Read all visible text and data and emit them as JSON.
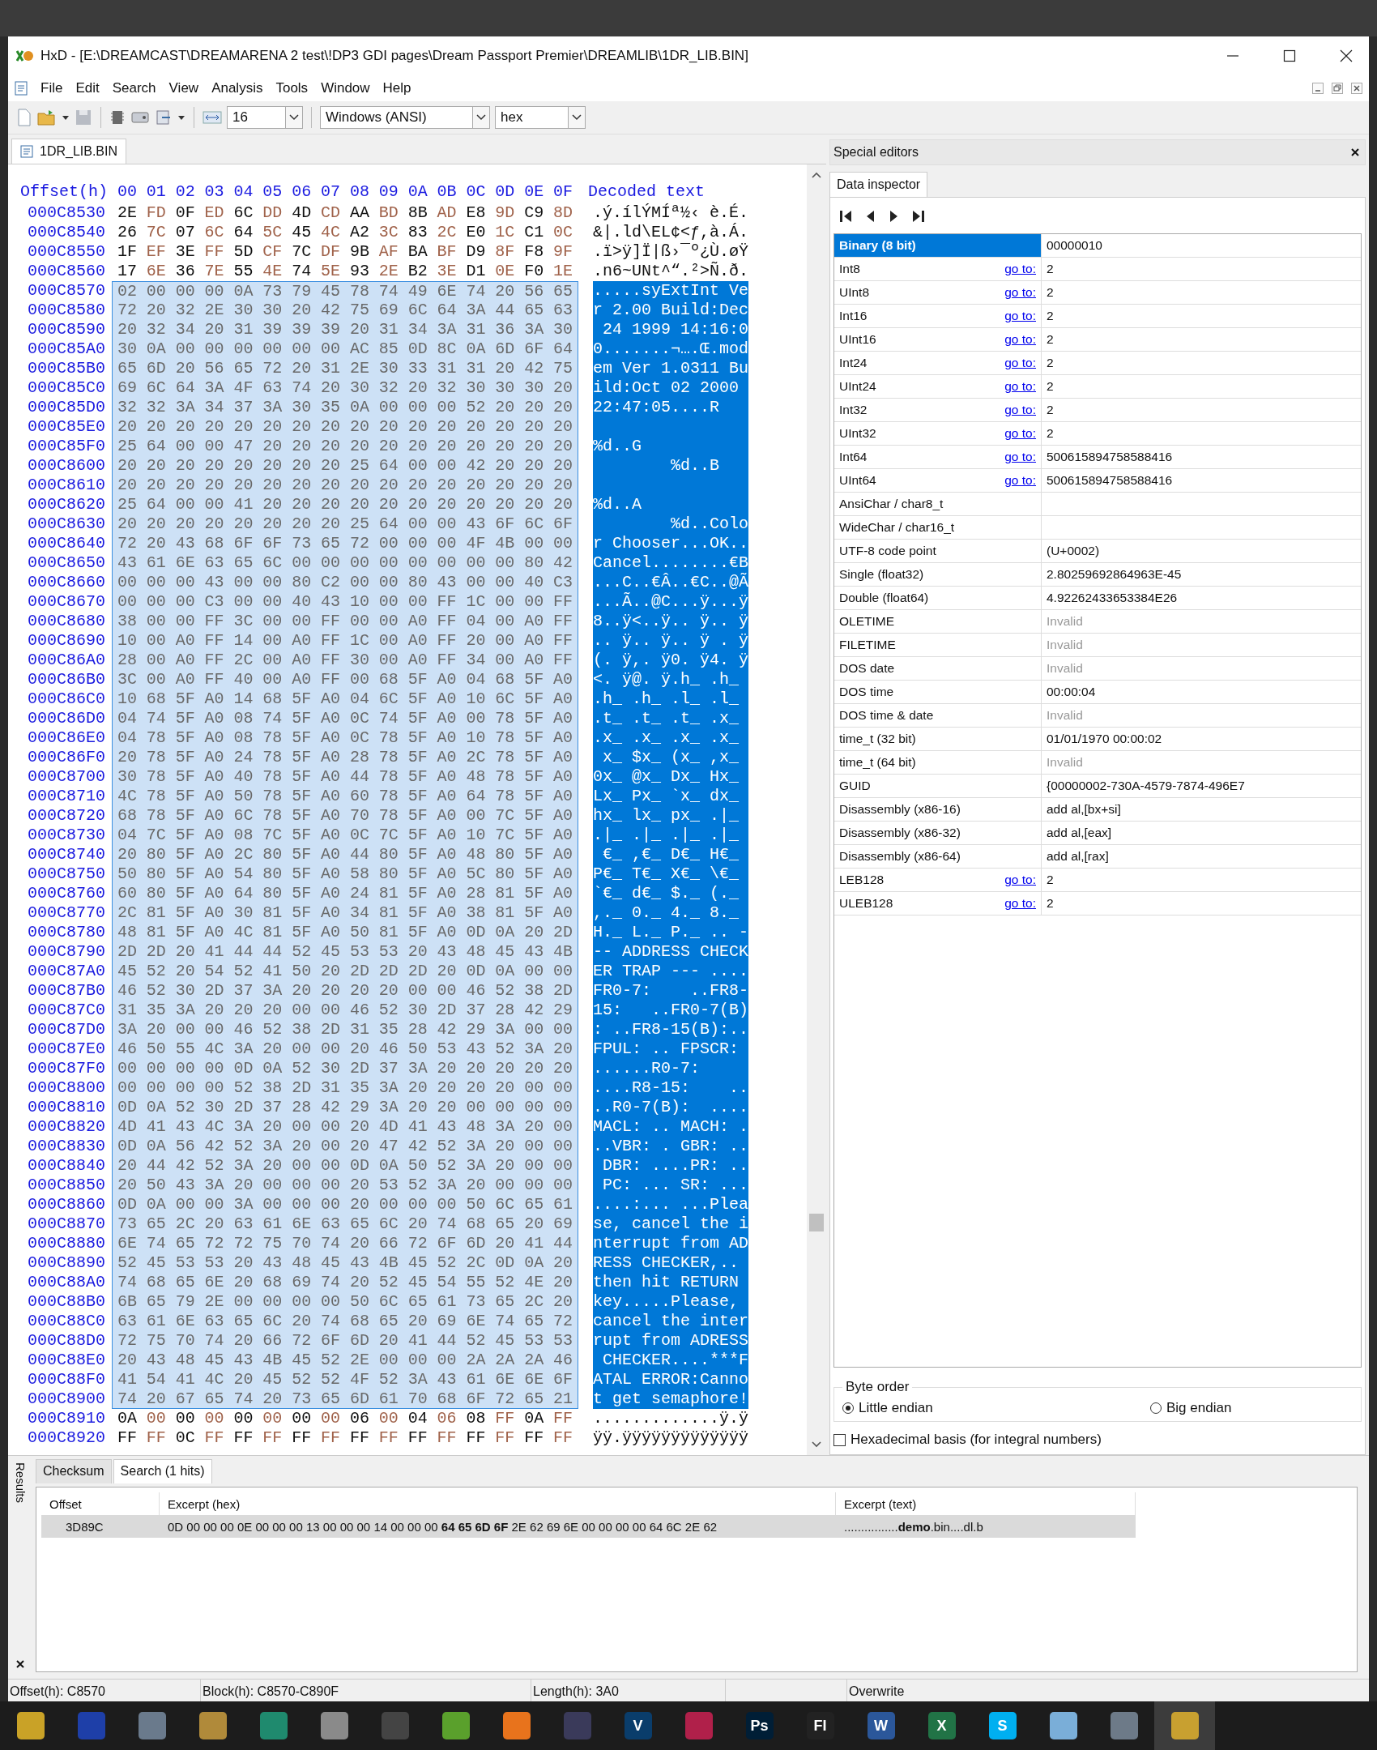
{
  "window": {
    "title": "HxD - [E:\\DREAMCAST\\DREAMARENA 2 test\\!DP3 GDI pages\\Dream Passport Premier\\DREAMLIB\\1DR_LIB.BIN]"
  },
  "menu": [
    "File",
    "Edit",
    "Search",
    "View",
    "Analysis",
    "Tools",
    "Window",
    "Help"
  ],
  "toolbar": {
    "bytes_per_row": "16",
    "encoding": "Windows (ANSI)",
    "view": "hex"
  },
  "file_tab": {
    "label": "1DR_LIB.BIN",
    "selected": true
  },
  "hex_view": {
    "offset_header": "Offset(h)",
    "columns": [
      "00",
      "01",
      "02",
      "03",
      "04",
      "05",
      "06",
      "07",
      "08",
      "09",
      "0A",
      "0B",
      "0C",
      "0D",
      "0E",
      "0F"
    ],
    "decoded_header": "Decoded text",
    "rows": [
      {
        "offset": "000C8530",
        "bytes": "2E FD 0F ED 6C DD 4D CD AA BD 8B AD E8 9D C9 8D",
        "text": ".ý.ílÝMÍª½‹ è.É.",
        "selected": false
      },
      {
        "offset": "000C8540",
        "bytes": "26 7C 07 6C 64 5C 45 4C A2 3C 83 2C E0 1C C1 0C",
        "text": "&|.ld\\EL¢<ƒ,à.Á.",
        "selected": false
      },
      {
        "offset": "000C8550",
        "bytes": "1F EF 3E FF 5D CF 7C DF 9B AF BA BF D9 8F F8 9F",
        "text": ".ï>ÿ]Ï|ß›¯º¿Ù.øŸ",
        "selected": false
      },
      {
        "offset": "000C8560",
        "bytes": "17 6E 36 7E 55 4E 74 5E 93 2E B2 3E D1 0E F0 1E",
        "text": ".n6~UNt^“.²>Ñ.ð.",
        "selected": false
      },
      {
        "offset": "000C8570",
        "bytes": "02 00 00 00 0A 73 79 45 78 74 49 6E 74 20 56 65",
        "text": ".....syExtInt Ve",
        "selected": true
      },
      {
        "offset": "000C8580",
        "bytes": "72 20 32 2E 30 30 20 42 75 69 6C 64 3A 44 65 63",
        "text": "r 2.00 Build:Dec",
        "selected": true
      },
      {
        "offset": "000C8590",
        "bytes": "20 32 34 20 31 39 39 39 20 31 34 3A 31 36 3A 30",
        "text": " 24 1999 14:16:0",
        "selected": true
      },
      {
        "offset": "000C85A0",
        "bytes": "30 0A 00 00 00 00 00 00 AC 85 0D 8C 0A 6D 6F 64",
        "text": "0.......¬….Œ.mod",
        "selected": true
      },
      {
        "offset": "000C85B0",
        "bytes": "65 6D 20 56 65 72 20 31 2E 30 33 31 31 20 42 75",
        "text": "em Ver 1.0311 Bu",
        "selected": true
      },
      {
        "offset": "000C85C0",
        "bytes": "69 6C 64 3A 4F 63 74 20 30 32 20 32 30 30 30 20",
        "text": "ild:Oct 02 2000 ",
        "selected": true
      },
      {
        "offset": "000C85D0",
        "bytes": "32 32 3A 34 37 3A 30 35 0A 00 00 00 52 20 20 20",
        "text": "22:47:05....R   ",
        "selected": true
      },
      {
        "offset": "000C85E0",
        "bytes": "20 20 20 20 20 20 20 20 20 20 20 20 20 20 20 20",
        "selected": true
      },
      {
        "offset": "000C85F0",
        "bytes": "25 64 00 00 47 20 20 20 20 20 20 20 20 20 20 20",
        "text": "%d..G           ",
        "selected": true
      },
      {
        "offset": "000C8600",
        "bytes": "20 20 20 20 20 20 20 20 25 64 00 00 42 20 20 20",
        "text": "        %d..B   ",
        "selected": true
      },
      {
        "offset": "000C8610",
        "bytes": "20 20 20 20 20 20 20 20 20 20 20 20 20 20 20 20",
        "selected": true
      },
      {
        "offset": "000C8620",
        "bytes": "25 64 00 00 41 20 20 20 20 20 20 20 20 20 20 20",
        "text": "%d..A           ",
        "selected": true
      },
      {
        "offset": "000C8630",
        "bytes": "20 20 20 20 20 20 20 20 25 64 00 00 43 6F 6C 6F",
        "text": "        %d..Colo",
        "selected": true
      },
      {
        "offset": "000C8640",
        "bytes": "72 20 43 68 6F 6F 73 65 72 00 00 00 4F 4B 00 00",
        "text": "r Chooser...OK..",
        "selected": true
      },
      {
        "offset": "000C8650",
        "bytes": "43 61 6E 63 65 6C 00 00 00 00 00 00 00 00 80 42",
        "text": "Cancel........€B",
        "selected": true
      },
      {
        "offset": "000C8660",
        "bytes": "00 00 00 43 00 00 80 C2 00 00 80 43 00 00 40 C3",
        "text": "...C..€Â..€C..@Ã",
        "selected": true
      },
      {
        "offset": "000C8670",
        "bytes": "00 00 00 C3 00 00 40 43 10 00 00 FF 1C 00 00 FF",
        "text": "...Ã..@C...ÿ...ÿ",
        "selected": true
      },
      {
        "offset": "000C8680",
        "bytes": "38 00 00 FF 3C 00 00 FF 00 00 A0 FF 04 00 A0 FF",
        "text": "8..ÿ<..ÿ.. ÿ.. ÿ",
        "selected": true
      },
      {
        "offset": "000C8690",
        "bytes": "10 00 A0 FF 14 00 A0 FF 1C 00 A0 FF 20 00 A0 FF",
        "text": ".. ÿ.. ÿ.. ÿ . ÿ",
        "selected": true
      },
      {
        "offset": "000C86A0",
        "bytes": "28 00 A0 FF 2C 00 A0 FF 30 00 A0 FF 34 00 A0 FF",
        "text": "(. ÿ,. ÿ0. ÿ4. ÿ",
        "selected": true
      },
      {
        "offset": "000C86B0",
        "bytes": "3C 00 A0 FF 40 00 A0 FF 00 68 5F A0 04 68 5F A0",
        "text": "<. ÿ@. ÿ.h_ .h_ ",
        "selected": true
      },
      {
        "offset": "000C86C0",
        "bytes": "10 68 5F A0 14 68 5F A0 04 6C 5F A0 10 6C 5F A0",
        "text": ".h_ .h_ .l_ .l_ ",
        "selected": true
      },
      {
        "offset": "000C86D0",
        "bytes": "04 74 5F A0 08 74 5F A0 0C 74 5F A0 00 78 5F A0",
        "text": ".t_ .t_ .t_ .x_ ",
        "selected": true
      },
      {
        "offset": "000C86E0",
        "bytes": "04 78 5F A0 08 78 5F A0 0C 78 5F A0 10 78 5F A0",
        "text": ".x_ .x_ .x_ .x_ ",
        "selected": true
      },
      {
        "offset": "000C86F0",
        "bytes": "20 78 5F A0 24 78 5F A0 28 78 5F A0 2C 78 5F A0",
        "text": " x_ $x_ (x_ ,x_ ",
        "selected": true
      },
      {
        "offset": "000C8700",
        "bytes": "30 78 5F A0 40 78 5F A0 44 78 5F A0 48 78 5F A0",
        "text": "0x_ @x_ Dx_ Hx_ ",
        "selected": true
      },
      {
        "offset": "000C8710",
        "bytes": "4C 78 5F A0 50 78 5F A0 60 78 5F A0 64 78 5F A0",
        "text": "Lx_ Px_ `x_ dx_ ",
        "selected": true
      },
      {
        "offset": "000C8720",
        "bytes": "68 78 5F A0 6C 78 5F A0 70 78 5F A0 00 7C 5F A0",
        "text": "hx_ lx_ px_ .|_ ",
        "selected": true
      },
      {
        "offset": "000C8730",
        "bytes": "04 7C 5F A0 08 7C 5F A0 0C 7C 5F A0 10 7C 5F A0",
        "text": ".|_ .|_ .|_ .|_ ",
        "selected": true
      },
      {
        "offset": "000C8740",
        "bytes": "20 80 5F A0 2C 80 5F A0 44 80 5F A0 48 80 5F A0",
        "text": " €_ ,€_ D€_ H€_ ",
        "selected": true
      },
      {
        "offset": "000C8750",
        "bytes": "50 80 5F A0 54 80 5F A0 58 80 5F A0 5C 80 5F A0",
        "text": "P€_ T€_ X€_ \\€_ ",
        "selected": true
      },
      {
        "offset": "000C8760",
        "bytes": "60 80 5F A0 64 80 5F A0 24 81 5F A0 28 81 5F A0",
        "text": "`€_ d€_ $._ (._ ",
        "selected": true
      },
      {
        "offset": "000C8770",
        "bytes": "2C 81 5F A0 30 81 5F A0 34 81 5F A0 38 81 5F A0",
        "text": ",._ 0._ 4._ 8._ ",
        "selected": true
      },
      {
        "offset": "000C8780",
        "bytes": "48 81 5F A0 4C 81 5F A0 50 81 5F A0 0D 0A 20 2D",
        "text": "H._ L._ P._ .. -",
        "selected": true
      },
      {
        "offset": "000C8790",
        "bytes": "2D 2D 20 41 44 44 52 45 53 53 20 43 48 45 43 4B",
        "text": "-- ADDRESS CHECK",
        "selected": true
      },
      {
        "offset": "000C87A0",
        "bytes": "45 52 20 54 52 41 50 20 2D 2D 2D 20 0D 0A 00 00",
        "text": "ER TRAP --- ....",
        "selected": true
      },
      {
        "offset": "000C87B0",
        "bytes": "46 52 30 2D 37 3A 20 20 20 20 00 00 46 52 38 2D",
        "text": "FR0-7:    ..FR8-",
        "selected": true
      },
      {
        "offset": "000C87C0",
        "bytes": "31 35 3A 20 20 20 00 00 46 52 30 2D 37 28 42 29",
        "text": "15:   ..FR0-7(B)",
        "selected": true
      },
      {
        "offset": "000C87D0",
        "bytes": "3A 20 00 00 46 52 38 2D 31 35 28 42 29 3A 00 00",
        "text": ": ..FR8-15(B):..",
        "selected": true
      },
      {
        "offset": "000C87E0",
        "bytes": "46 50 55 4C 3A 20 00 00 20 46 50 53 43 52 3A 20",
        "text": "FPUL: .. FPSCR: ",
        "selected": true
      },
      {
        "offset": "000C87F0",
        "bytes": "00 00 00 00 0D 0A 52 30 2D 37 3A 20 20 20 20 20",
        "text": "......R0-7:     ",
        "selected": true
      },
      {
        "offset": "000C8800",
        "bytes": "00 00 00 00 52 38 2D 31 35 3A 20 20 20 20 00 00",
        "text": "....R8-15:    ..",
        "selected": true
      },
      {
        "offset": "000C8810",
        "bytes": "0D 0A 52 30 2D 37 28 42 29 3A 20 20 00 00 00 00",
        "text": "..R0-7(B):  ....",
        "selected": true
      },
      {
        "offset": "000C8820",
        "bytes": "4D 41 43 4C 3A 20 00 00 20 4D 41 43 48 3A 20 00",
        "text": "MACL: .. MACH: .",
        "selected": true
      },
      {
        "offset": "000C8830",
        "bytes": "0D 0A 56 42 52 3A 20 00 20 47 42 52 3A 20 00 00",
        "text": "..VBR: . GBR: ..",
        "selected": true
      },
      {
        "offset": "000C8840",
        "bytes": "20 44 42 52 3A 20 00 00 0D 0A 50 52 3A 20 00 00",
        "text": " DBR: ....PR: ..",
        "selected": true
      },
      {
        "offset": "000C8850",
        "bytes": "20 50 43 3A 20 00 00 00 20 53 52 3A 20 00 00 00",
        "text": " PC: ... SR: ...",
        "selected": true
      },
      {
        "offset": "000C8860",
        "bytes": "0D 0A 00 00 3A 00 00 00 20 00 00 00 50 6C 65 61",
        "text": "....:... ...Plea",
        "selected": true
      },
      {
        "offset": "000C8870",
        "bytes": "73 65 2C 20 63 61 6E 63 65 6C 20 74 68 65 20 69",
        "text": "se, cancel the i",
        "selected": true
      },
      {
        "offset": "000C8880",
        "bytes": "6E 74 65 72 72 75 70 74 20 66 72 6F 6D 20 41 44",
        "text": "nterrupt from AD",
        "selected": true
      },
      {
        "offset": "000C8890",
        "bytes": "52 45 53 53 20 43 48 45 43 4B 45 52 2C 0D 0A 20",
        "text": "RESS CHECKER,.. ",
        "selected": true
      },
      {
        "offset": "000C88A0",
        "bytes": "74 68 65 6E 20 68 69 74 20 52 45 54 55 52 4E 20",
        "text": "then hit RETURN ",
        "selected": true
      },
      {
        "offset": "000C88B0",
        "bytes": "6B 65 79 2E 00 00 00 00 50 6C 65 61 73 65 2C 20",
        "text": "key.....Please, ",
        "selected": true
      },
      {
        "offset": "000C88C0",
        "bytes": "63 61 6E 63 65 6C 20 74 68 65 20 69 6E 74 65 72",
        "text": "cancel the inter",
        "selected": true
      },
      {
        "offset": "000C88D0",
        "bytes": "72 75 70 74 20 66 72 6F 6D 20 41 44 52 45 53 53",
        "text": "rupt from ADRESS",
        "selected": true
      },
      {
        "offset": "000C88E0",
        "bytes": "20 43 48 45 43 4B 45 52 2E 00 00 00 2A 2A 2A 46",
        "text": " CHECKER....***F",
        "selected": true
      },
      {
        "offset": "000C88F0",
        "bytes": "41 54 41 4C 20 45 52 52 4F 52 3A 43 61 6E 6E 6F",
        "text": "ATAL ERROR:Canno",
        "selected": true
      },
      {
        "offset": "000C8900",
        "bytes": "74 20 67 65 74 20 73 65 6D 61 70 68 6F 72 65 21",
        "text": "t get semaphore!",
        "selected": true
      },
      {
        "offset": "000C8910",
        "bytes": "0A 00 00 00 00 00 00 00 06 00 04 06 08 FF 0A FF",
        "text": ".............ÿ.ÿ",
        "selected": false
      },
      {
        "offset": "000C8920",
        "bytes": "FF FF 0C FF FF FF FF FF FF FF FF FF FF FF FF FF",
        "text": "ÿÿ.ÿÿÿÿÿÿÿÿÿÿÿÿÿ",
        "selected": false
      }
    ]
  },
  "special_editors": {
    "title": "Special editors",
    "tab": "Data inspector",
    "inspector": [
      {
        "name": "Binary (8 bit)",
        "value": "00000010",
        "invalid": false,
        "selected": true
      },
      {
        "name": "Int8",
        "link": "go to:",
        "value": "2",
        "invalid": false,
        "selected": false
      },
      {
        "name": "UInt8",
        "link": "go to:",
        "value": "2",
        "invalid": false,
        "selected": false
      },
      {
        "name": "Int16",
        "link": "go to:",
        "value": "2",
        "invalid": false,
        "selected": false
      },
      {
        "name": "UInt16",
        "link": "go to:",
        "value": "2",
        "invalid": false,
        "selected": false
      },
      {
        "name": "Int24",
        "link": "go to:",
        "value": "2",
        "invalid": false,
        "selected": false
      },
      {
        "name": "UInt24",
        "link": "go to:",
        "value": "2",
        "invalid": false,
        "selected": false
      },
      {
        "name": "Int32",
        "link": "go to:",
        "value": "2",
        "invalid": false,
        "selected": false
      },
      {
        "name": "UInt32",
        "link": "go to:",
        "value": "2",
        "invalid": false,
        "selected": false
      },
      {
        "name": "Int64",
        "link": "go to:",
        "value": "500615894758588416",
        "invalid": false,
        "selected": false
      },
      {
        "name": "UInt64",
        "link": "go to:",
        "value": "500615894758588416",
        "invalid": false,
        "selected": false
      },
      {
        "name": "AnsiChar / char8_t",
        "selected": false
      },
      {
        "name": "WideChar / char16_t",
        "selected": false
      },
      {
        "name": "UTF-8 code point",
        "value": "(U+0002)",
        "invalid": false,
        "selected": false
      },
      {
        "name": "Single (float32)",
        "value": "2.80259692864963E-45",
        "invalid": false,
        "selected": false
      },
      {
        "name": "Double (float64)",
        "value": "4.92262433653384E26",
        "invalid": false,
        "selected": false
      },
      {
        "name": "OLETIME",
        "value": "Invalid",
        "invalid": true,
        "selected": false
      },
      {
        "name": "FILETIME",
        "value": "Invalid",
        "invalid": true,
        "selected": false
      },
      {
        "name": "DOS date",
        "value": "Invalid",
        "invalid": true,
        "selected": false
      },
      {
        "name": "DOS time",
        "value": "00:00:04",
        "invalid": false,
        "selected": false
      },
      {
        "name": "DOS time & date",
        "value": "Invalid",
        "invalid": true,
        "selected": false
      },
      {
        "name": "time_t (32 bit)",
        "value": "01/01/1970 00:00:02",
        "invalid": false,
        "selected": false
      },
      {
        "name": "time_t (64 bit)",
        "value": "Invalid",
        "invalid": true,
        "selected": false
      },
      {
        "name": "GUID",
        "value": "{00000002-730A-4579-7874-496E7",
        "invalid": false,
        "selected": false
      },
      {
        "name": "Disassembly (x86-16)",
        "value": "add al,[bx+si]",
        "invalid": false,
        "selected": false
      },
      {
        "name": "Disassembly (x86-32)",
        "value": "add al,[eax]",
        "invalid": false,
        "selected": false
      },
      {
        "name": "Disassembly (x86-64)",
        "value": "add al,[rax]",
        "invalid": false,
        "selected": false
      },
      {
        "name": "LEB128",
        "link": "go to:",
        "value": "2",
        "invalid": false,
        "selected": false
      },
      {
        "name": "ULEB128",
        "link": "go to:",
        "value": "2",
        "invalid": false,
        "selected": false
      }
    ],
    "byte_order": {
      "title": "Byte order",
      "options": [
        {
          "label": "Little endian",
          "selected": true
        },
        {
          "label": "Big endian",
          "selected": false
        }
      ]
    },
    "hex_basis": {
      "label": "Hexadecimal basis (for integral numbers)",
      "checked": false
    }
  },
  "results": {
    "side_label": "Results",
    "tabs": [
      {
        "label": "Checksum",
        "selected": false
      },
      {
        "label": "Search (1 hits)",
        "selected": true
      }
    ],
    "columns": [
      "Offset",
      "Excerpt (hex)",
      "Excerpt (text)"
    ],
    "rows": [
      {
        "offset": "3D89C",
        "hex": "0D 00 00 00 0E 00 00 00 13 00 00 00 14 00 00 00 **64 65 6D 6F** 2E 62 69 6E 00 00 00 00 64 6C 2E 62",
        "text": "................**demo**.bin....dl.b",
        "selected": true
      }
    ]
  },
  "status_bar": [
    "Offset(h): C8570",
    "Block(h): C8570-C890F",
    "Length(h): 3A0",
    "Overwrite"
  ],
  "taskbar": [
    {
      "color": "#c9a227",
      "selected": false
    },
    {
      "color": "#1e3fa8",
      "selected": false
    },
    {
      "color": "#6a7a8c",
      "selected": false
    },
    {
      "color": "#b08a3a",
      "selected": false
    },
    {
      "color": "#1f8a6e",
      "selected": false
    },
    {
      "color": "#8a8a8a",
      "selected": false
    },
    {
      "color": "#444444",
      "selected": false
    },
    {
      "color": "#5aa02c",
      "selected": false
    },
    {
      "color": "#e8731c",
      "selected": false
    },
    {
      "color": "#3a3a5a",
      "selected": false
    },
    {
      "label": "V",
      "color": "#0a3d6b",
      "selected": false
    },
    {
      "color": "#b0204a",
      "selected": false
    },
    {
      "label": "Ps",
      "color": "#001e36",
      "selected": false
    },
    {
      "label": "FI",
      "color": "#222222",
      "selected": false
    },
    {
      "label": "W",
      "color": "#2b579a",
      "selected": false
    },
    {
      "label": "X",
      "color": "#217346",
      "selected": false
    },
    {
      "label": "S",
      "color": "#00aff0",
      "selected": false
    },
    {
      "color": "#7aaed8",
      "selected": false
    },
    {
      "color": "#6d7a88",
      "selected": false
    },
    {
      "color": "#c8a030",
      "selected": true
    }
  ]
}
